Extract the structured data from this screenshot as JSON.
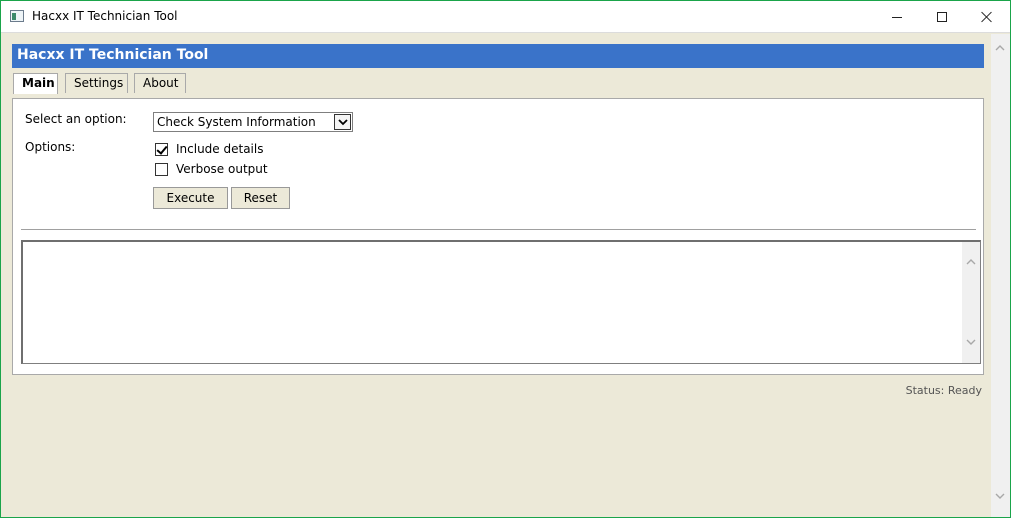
{
  "window": {
    "title": "Hacxx IT Technician Tool"
  },
  "app": {
    "banner_title": "Hacxx IT Technician Tool",
    "accent_color": "#3a73c9"
  },
  "tabs": [
    {
      "label": "Main",
      "active": true
    },
    {
      "label": "Settings",
      "active": false
    },
    {
      "label": "About",
      "active": false
    }
  ],
  "main": {
    "select_label": "Select an option:",
    "select_value": "Check System Information",
    "options_label": "Options:",
    "checkboxes": [
      {
        "label": "Include details",
        "checked": true
      },
      {
        "label": "Verbose output",
        "checked": false
      }
    ],
    "execute_label": "Execute",
    "reset_label": "Reset",
    "output_text": ""
  },
  "status": {
    "text": "Status: Ready"
  }
}
